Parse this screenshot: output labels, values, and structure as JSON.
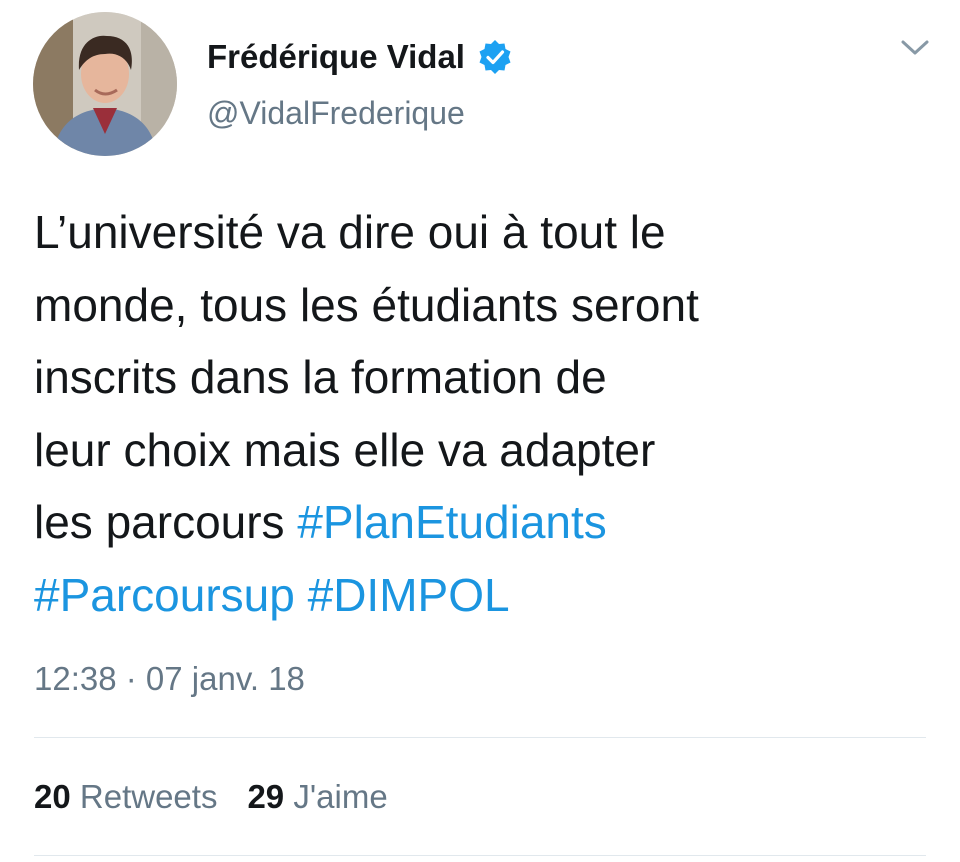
{
  "author": {
    "display_name": "Frédérique Vidal",
    "handle": "@VidalFrederique",
    "verified": true,
    "avatar_icon": "profile-photo"
  },
  "tweet": {
    "lines": [
      [
        {
          "text": "L’université va dire oui à tout le",
          "hashtag": false
        }
      ],
      [
        {
          "text": "monde, tous les étudiants seront",
          "hashtag": false
        }
      ],
      [
        {
          "text": "inscrits dans la formation de",
          "hashtag": false
        }
      ],
      [
        {
          "text": "leur choix mais elle va adapter",
          "hashtag": false
        }
      ],
      [
        {
          "text": "les parcours ",
          "hashtag": false
        },
        {
          "text": "#PlanEtudiants",
          "hashtag": true
        }
      ],
      [
        {
          "text": "#Parcoursup",
          "hashtag": true
        },
        {
          "text": " ",
          "hashtag": false
        },
        {
          "text": "#DIMPOL",
          "hashtag": true
        }
      ]
    ],
    "timestamp": "12:38 · 07 janv. 18"
  },
  "stats": {
    "retweets_count": "20",
    "retweets_label": "Retweets",
    "likes_count": "29",
    "likes_label": "J'aime"
  },
  "colors": {
    "hashtag": "#1b95e0",
    "secondary_text": "#657786",
    "verified_badge": "#1da1f2",
    "divider": "#e1e8ed"
  },
  "icons": {
    "verified": "verified-badge-icon",
    "caret": "chevron-down-icon"
  }
}
